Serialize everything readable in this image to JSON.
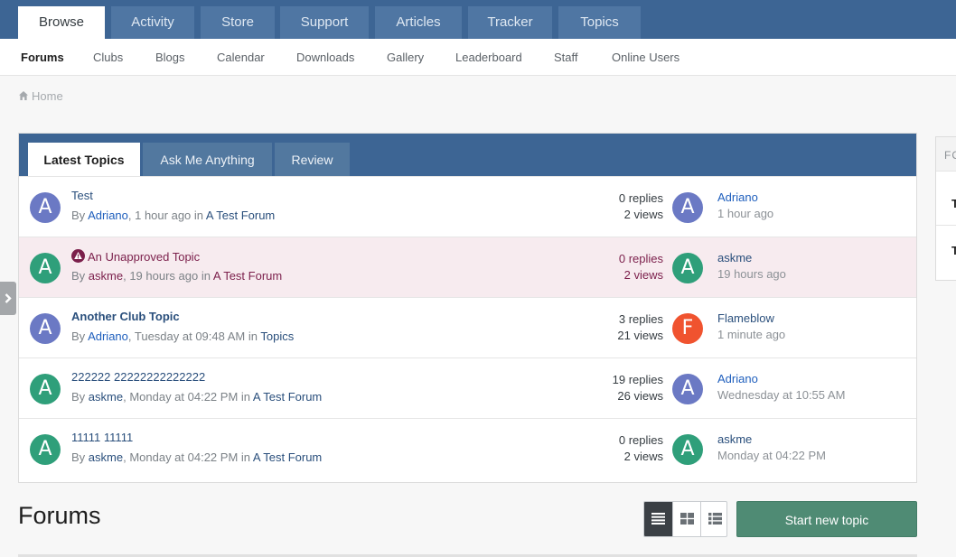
{
  "topnav": {
    "tabs": [
      {
        "label": "Browse",
        "active": true
      },
      {
        "label": "Activity"
      },
      {
        "label": "Store"
      },
      {
        "label": "Support"
      },
      {
        "label": "Articles"
      },
      {
        "label": "Tracker"
      },
      {
        "label": "Topics"
      }
    ]
  },
  "subnav": {
    "items": [
      {
        "label": "Forums",
        "active": true
      },
      {
        "label": "Clubs"
      },
      {
        "label": "Blogs"
      },
      {
        "label": "Calendar"
      },
      {
        "label": "Downloads"
      },
      {
        "label": "Gallery"
      },
      {
        "label": "Leaderboard"
      },
      {
        "label": "Staff"
      },
      {
        "label": "Online Users"
      }
    ]
  },
  "breadcrumb": {
    "home": "Home"
  },
  "widget": {
    "tabs": [
      {
        "label": "Latest Topics",
        "active": true
      },
      {
        "label": "Ask Me Anything"
      },
      {
        "label": "Review"
      }
    ],
    "topics": [
      {
        "title": "Test",
        "by": "By",
        "author": "Adriano",
        "time": ", 1 hour ago in",
        "forum": "A Test Forum",
        "replies": "0 replies",
        "views": "2 views",
        "last_user": "Adriano",
        "last_time": "1 hour ago",
        "avatar": "A",
        "last_avatar": "A"
      },
      {
        "title": "An Unapproved Topic",
        "by": "By",
        "author": "askme",
        "time": ", 19 hours ago in",
        "forum": "A Test Forum",
        "replies": "0 replies",
        "views": "2 views",
        "last_user": "askme",
        "last_time": "19 hours ago",
        "avatar": "A",
        "last_avatar": "A"
      },
      {
        "title": "Another Club Topic",
        "by": "By",
        "author": "Adriano",
        "time": ", Tuesday at 09:48 AM in",
        "forum": "Topics",
        "replies": "3 replies",
        "views": "21 views",
        "last_user": "Flameblow",
        "last_time": "1 minute ago",
        "avatar": "A",
        "last_avatar": "F"
      },
      {
        "title": "222222 22222222222222",
        "by": "By",
        "author": "askme",
        "time": ", Monday at 04:22 PM in",
        "forum": "A Test Forum",
        "replies": "19 replies",
        "views": "26 views",
        "last_user": "Adriano",
        "last_time": "Wednesday at 10:55 AM",
        "avatar": "A",
        "last_avatar": "A"
      },
      {
        "title": "11111 11111",
        "by": "By",
        "author": "askme",
        "time": ", Monday at 04:22 PM in",
        "forum": "A Test Forum",
        "replies": "0 replies",
        "views": "2 views",
        "last_user": "askme",
        "last_time": "Monday at 04:22 PM",
        "avatar": "A",
        "last_avatar": "A"
      }
    ]
  },
  "sidebar": {
    "header": "FO",
    "entries": [
      "T",
      "T"
    ]
  },
  "main": {
    "title": "Forums",
    "start_button": "Start new topic"
  },
  "colors": {
    "brand": "#3d6594",
    "avatar_purple": "#6b79c4",
    "avatar_green": "#2f9f7a",
    "avatar_orange": "#f0532f",
    "start_button": "#4f8b74"
  },
  "icons": {
    "home": "home-icon",
    "warning": "warning-icon",
    "expand": "chevron-right-icon",
    "view_table": "table-view-icon",
    "view_grid": "grid-view-icon",
    "view_list": "list-view-icon"
  }
}
